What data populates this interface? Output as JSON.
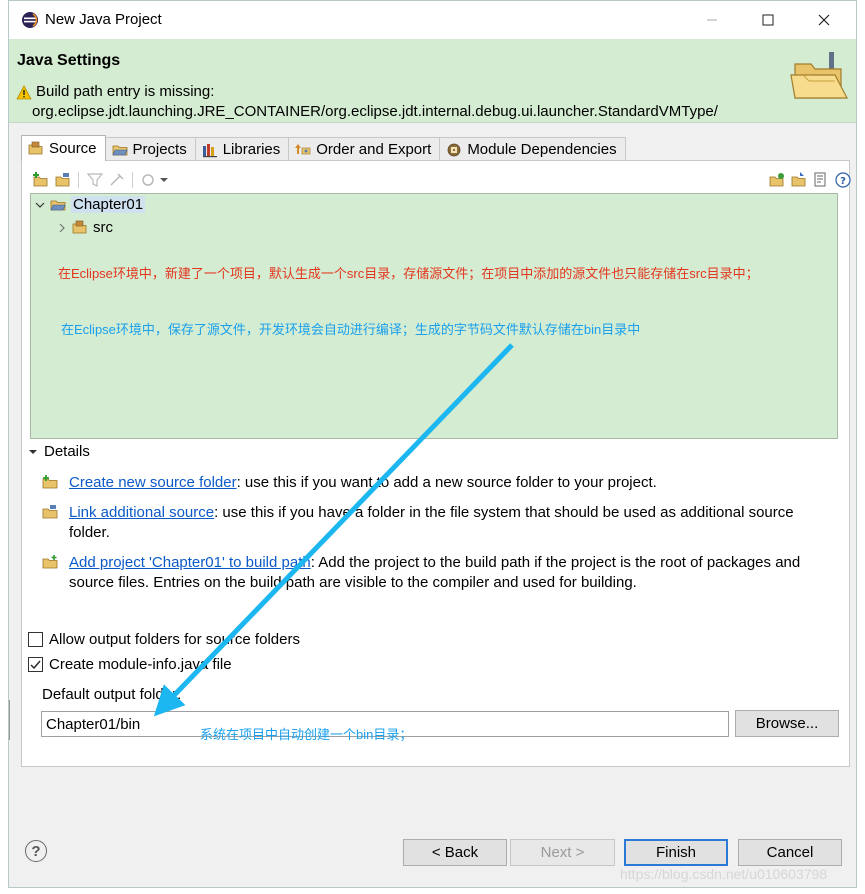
{
  "window": {
    "title": "New Java Project"
  },
  "header": {
    "title": "Java Settings",
    "message_line1": "Build path entry is missing:",
    "message_line2": "org.eclipse.jdt.launching.JRE_CONTAINER/org.eclipse.jdt.internal.debug.ui.launcher.StandardVMType/"
  },
  "tabs": [
    {
      "label": "Source",
      "icon": "source-folder-icon",
      "active": true
    },
    {
      "label": "Projects",
      "icon": "projects-icon",
      "active": false
    },
    {
      "label": "Libraries",
      "icon": "libraries-icon",
      "active": false
    },
    {
      "label": "Order and Export",
      "icon": "order-export-icon",
      "active": false
    },
    {
      "label": "Module Dependencies",
      "icon": "module-icon",
      "active": false
    }
  ],
  "tree": {
    "project": "Chapter01",
    "src": "src"
  },
  "annotations": {
    "note1": "在Eclipse环境中，新建了一个项目，默认生成一个src目录，存储源文件；在项目中添加的源文件也只能存储在src目录中；",
    "note2": "在Eclipse环境中，保存了源文件，开发环境会自动进行编译；生成的字节码文件默认存储在bin目录中",
    "note3": "系统在项目中自动创建一个bin目录；",
    "arrow_color": "#1cb6f0"
  },
  "details": {
    "label": "Details",
    "items": [
      {
        "link": "Create new source folder",
        "text": ": use this if you want to add a new source folder to your project."
      },
      {
        "link": "Link additional source",
        "text": ": use this if you have a folder in the file system that should be used as additional source folder."
      },
      {
        "link": "Add project 'Chapter01' to build path",
        "text": ": Add the project to the build path if the project is the root of packages and source files. Entries on the build path are visible to the compiler and used for building."
      }
    ]
  },
  "options": {
    "allow_output": {
      "label": "Allow output folders for source folders",
      "checked": false
    },
    "module_info": {
      "label": "Create module-info.java file",
      "checked": true
    }
  },
  "output": {
    "label": "Default output folder:",
    "value": "Chapter01/bin",
    "browse": "Browse..."
  },
  "buttons": {
    "back": "< Back",
    "next": "Next >",
    "finish": "Finish",
    "cancel": "Cancel"
  },
  "help_glyph": "?",
  "watermark": "https://blog.csdn.net/u010603798"
}
